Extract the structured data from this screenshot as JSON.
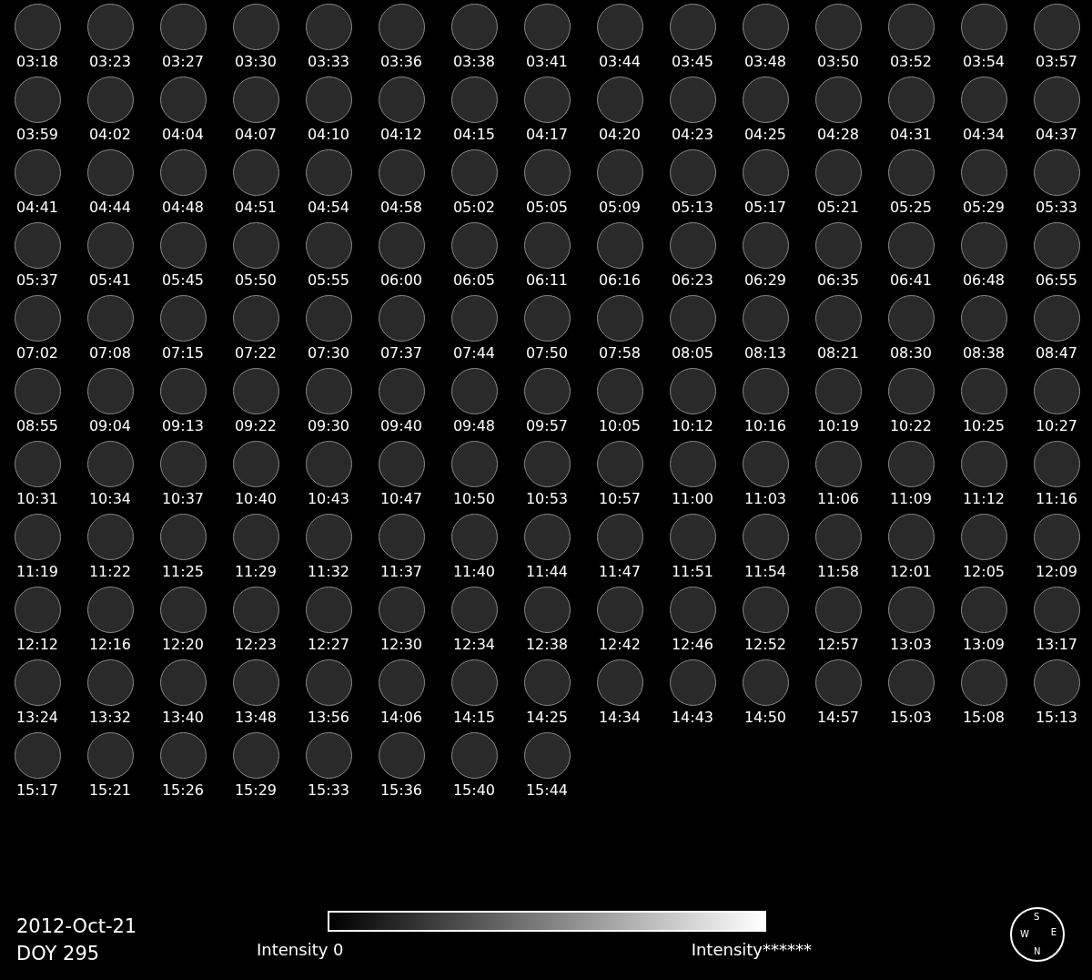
{
  "frames": [
    "03:18",
    "03:23",
    "03:27",
    "03:30",
    "03:33",
    "03:36",
    "03:38",
    "03:41",
    "03:44",
    "03:45",
    "03:48",
    "03:50",
    "03:52",
    "03:54",
    "03:57",
    "03:59",
    "04:02",
    "04:04",
    "04:07",
    "04:10",
    "04:12",
    "04:15",
    "04:17",
    "04:20",
    "04:23",
    "04:25",
    "04:28",
    "04:31",
    "04:34",
    "04:37",
    "04:41",
    "04:44",
    "04:48",
    "04:51",
    "04:54",
    "04:58",
    "05:02",
    "05:05",
    "05:09",
    "05:13",
    "05:17",
    "05:21",
    "05:25",
    "05:29",
    "05:33",
    "05:37",
    "05:41",
    "05:45",
    "05:50",
    "05:55",
    "06:00",
    "06:05",
    "06:11",
    "06:16",
    "06:23",
    "06:29",
    "06:35",
    "06:41",
    "06:48",
    "06:55",
    "07:02",
    "07:08",
    "07:15",
    "07:22",
    "07:30",
    "07:37",
    "07:44",
    "07:50",
    "07:58",
    "08:05",
    "08:13",
    "08:21",
    "08:30",
    "08:38",
    "08:47",
    "08:55",
    "09:04",
    "09:13",
    "09:22",
    "09:30",
    "09:40",
    "09:48",
    "09:57",
    "10:05",
    "10:12",
    "10:16",
    "10:19",
    "10:22",
    "10:25",
    "10:27",
    "10:31",
    "10:34",
    "10:37",
    "10:40",
    "10:43",
    "10:47",
    "10:50",
    "10:53",
    "10:57",
    "11:00",
    "11:03",
    "11:06",
    "11:09",
    "11:12",
    "11:16",
    "11:19",
    "11:22",
    "11:25",
    "11:29",
    "11:32",
    "11:37",
    "11:40",
    "11:44",
    "11:47",
    "11:51",
    "11:54",
    "11:58",
    "12:01",
    "12:05",
    "12:09",
    "12:12",
    "12:16",
    "12:20",
    "12:23",
    "12:27",
    "12:30",
    "12:34",
    "12:38",
    "12:42",
    "12:46",
    "12:52",
    "12:57",
    "13:03",
    "13:09",
    "13:17",
    "13:24",
    "13:32",
    "13:40",
    "13:48",
    "13:56",
    "14:06",
    "14:15",
    "14:25",
    "14:34",
    "14:43",
    "14:50",
    "14:57",
    "15:03",
    "15:08",
    "15:13",
    "15:17",
    "15:21",
    "15:26",
    "15:29",
    "15:33",
    "15:36",
    "15:40",
    "15:44"
  ],
  "date": "2012-Oct-21",
  "doy": "DOY 295",
  "colorbar": {
    "min_label": "Intensity 0",
    "max_label": "Intensity******"
  },
  "compass": {
    "top": "S",
    "left": "W",
    "right": "E",
    "bottom": "N"
  }
}
